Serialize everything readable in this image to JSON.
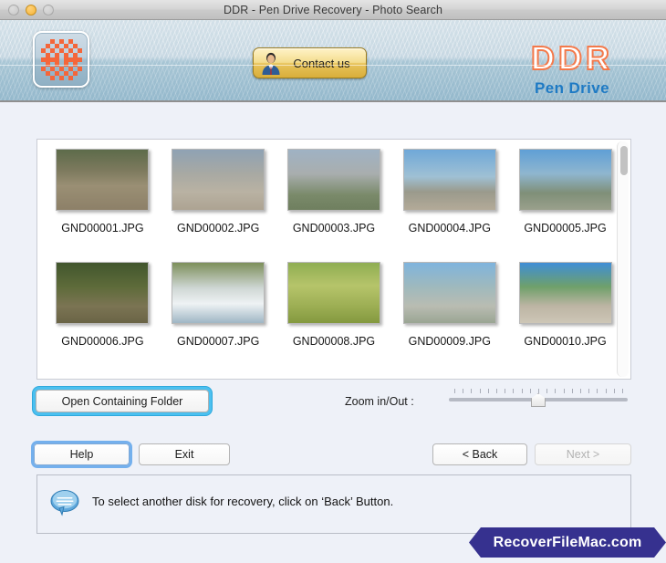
{
  "window": {
    "title": "DDR - Pen Drive Recovery - Photo Search",
    "controls": {
      "close": "close-button",
      "minimize": "minimize-button",
      "maximize": "maximize-button"
    }
  },
  "header": {
    "app_icon_name": "ddr-app-icon",
    "contact_button": {
      "label": "Contact us",
      "icon": "person-icon"
    },
    "brand": {
      "main": "DDR",
      "sub": "Pen Drive",
      "main_color": "#f4794a",
      "sub_color": "#1e7ac4"
    }
  },
  "thumbnails": {
    "rows": [
      [
        {
          "name": "GND00001.JPG"
        },
        {
          "name": "GND00002.JPG"
        },
        {
          "name": "GND00003.JPG"
        },
        {
          "name": "GND00004.JPG"
        },
        {
          "name": "GND00005.JPG"
        }
      ],
      [
        {
          "name": "GND00006.JPG"
        },
        {
          "name": "GND00007.JPG"
        },
        {
          "name": "GND00008.JPG"
        },
        {
          "name": "GND00009.JPG"
        },
        {
          "name": "GND00010.JPG"
        }
      ]
    ],
    "scrollbar": {
      "name": "vertical-scrollbar",
      "position": "top"
    }
  },
  "controls": {
    "open_containing_folder": "Open Containing Folder",
    "zoom_label": "Zoom in/Out :",
    "zoom_slider": {
      "ticks": 21,
      "value_percent": 50
    },
    "help": "Help",
    "exit": "Exit",
    "back": "< Back",
    "next": "Next >",
    "next_disabled": true
  },
  "status": {
    "icon": "speech-bubble-icon",
    "message": "To select another disk for recovery, click on ‘Back’ Button."
  },
  "watermark": {
    "text": "RecoverFileMac.com",
    "color": "#36318f"
  }
}
